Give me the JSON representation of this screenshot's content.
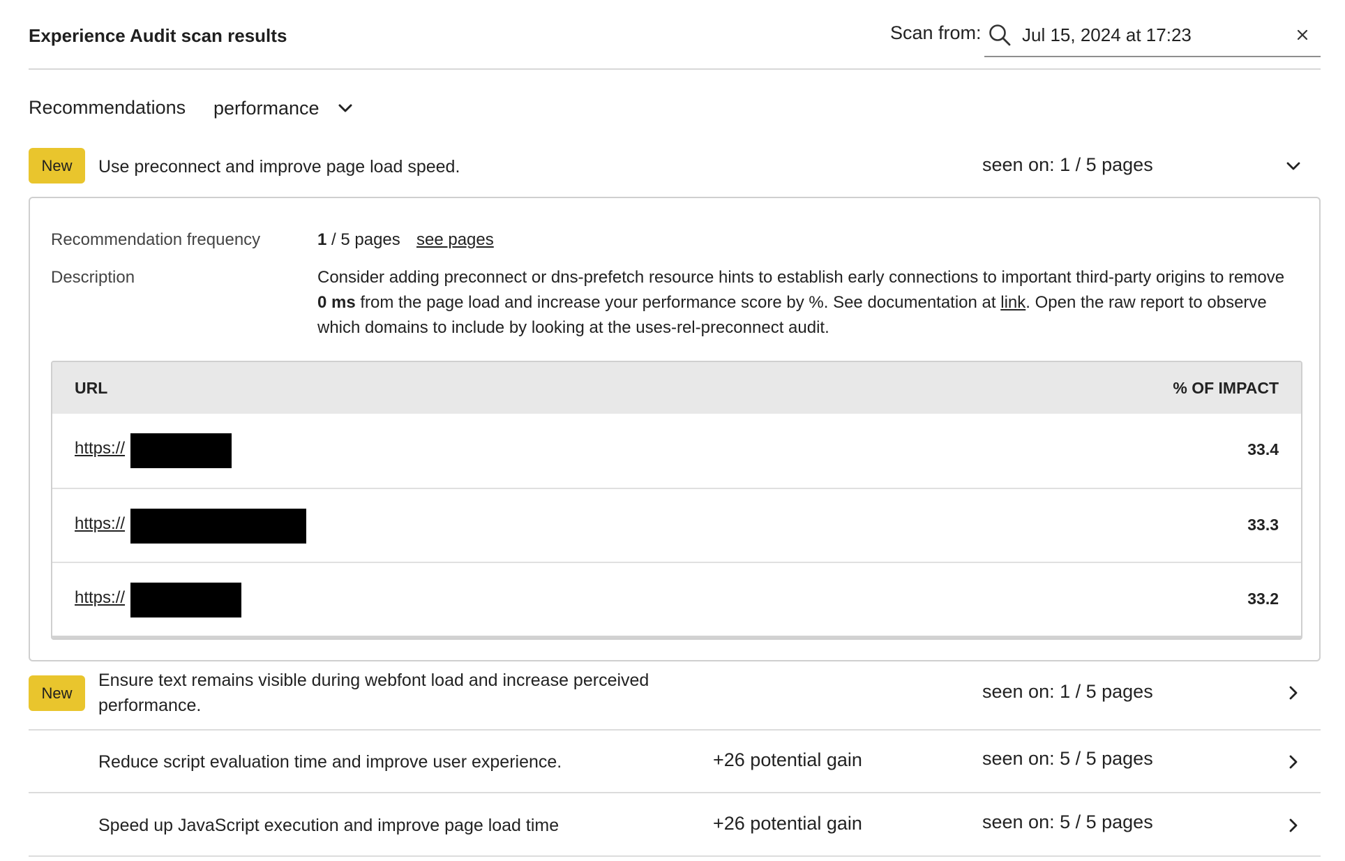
{
  "header": {
    "title": "Experience Audit scan results",
    "scan_label": "Scan from:",
    "search_value": "Jul 15, 2024 at 17:23",
    "search_icon": "search-icon",
    "clear_icon": "close-icon"
  },
  "recommendations": {
    "label": "Recommendations",
    "selected": "performance"
  },
  "items": [
    {
      "badge": "New",
      "text": "Use preconnect and improve page load speed.",
      "seen": "seen on: 1 / 5 pages",
      "expanded": true
    },
    {
      "badge": "New",
      "text": "Ensure text remains visible during webfont load and increase perceived performance.",
      "seen": "seen on: 1 / 5 pages",
      "expanded": false
    },
    {
      "badge": "",
      "text": "Reduce script evaluation time and improve user experience.",
      "gain": "+26 potential gain",
      "seen": "seen on: 5 / 5 pages",
      "expanded": false
    },
    {
      "badge": "",
      "text": "Speed up JavaScript execution and improve page load time",
      "gain": "+26 potential gain",
      "seen": "seen on: 5 / 5 pages",
      "expanded": false
    }
  ],
  "detail": {
    "frequency_label": "Recommendation frequency",
    "frequency_count": "1",
    "frequency_rest": " / 5 pages",
    "see_pages": "see pages",
    "description_label": "Description",
    "description_part1": "Consider adding preconnect or dns-prefetch resource hints to establish early connections to important third-party origins to remove ",
    "description_bold": "0 ms",
    "description_part2": " from the page load and increase your performance score by %. See documentation at ",
    "description_link": "link",
    "description_part3": ". Open the raw report to observe which domains to include by looking at the uses-rel-preconnect audit.",
    "table": {
      "headers": [
        "URL",
        "% OF IMPACT"
      ],
      "rows": [
        {
          "url": "https://",
          "impact": "33.4"
        },
        {
          "url": "https://",
          "impact": "33.3"
        },
        {
          "url": "https://",
          "impact": "33.2"
        }
      ]
    }
  },
  "colors": {
    "badge": "#e9c52d",
    "table_header": "#e8e8e8",
    "redaction": "#000000"
  }
}
